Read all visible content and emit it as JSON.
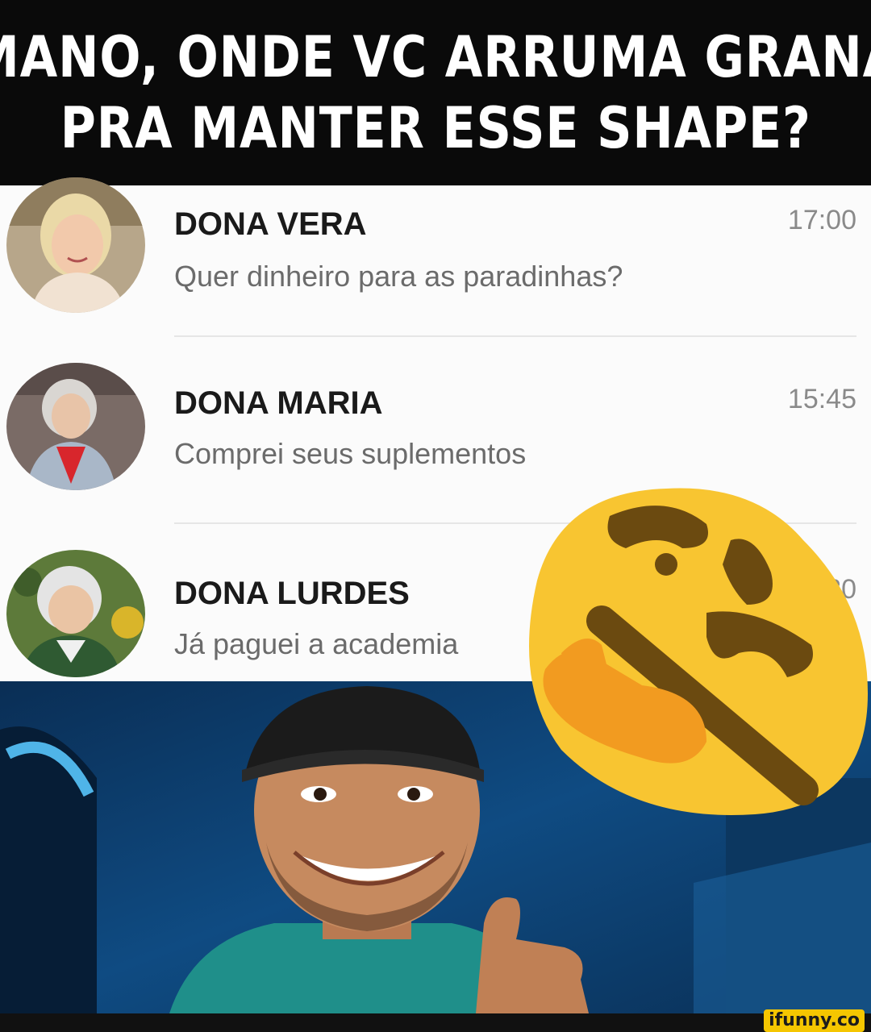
{
  "caption": {
    "line1": "MANO, ONDE VC ARRUMA GRANA",
    "line2": "PRA MANTER ESSE SHAPE?"
  },
  "chats": [
    {
      "name": "DONA VERA",
      "message": "Quer dinheiro para as paradinhas?",
      "time": "17:00"
    },
    {
      "name": "DONA MARIA",
      "message": "Comprei seus suplementos",
      "time": "15:45"
    },
    {
      "name": "DONA LURDES",
      "message": "Já paguei a academia",
      "time": ":20"
    }
  ],
  "emoji": {
    "icon": "thinking-face-icon",
    "color": "#f8c531"
  },
  "watermark": "ifunny.co",
  "colors": {
    "caption_bg": "#0a0a0a",
    "photo_bg": "#0b3d6e",
    "shirt": "#1f8f8a"
  }
}
